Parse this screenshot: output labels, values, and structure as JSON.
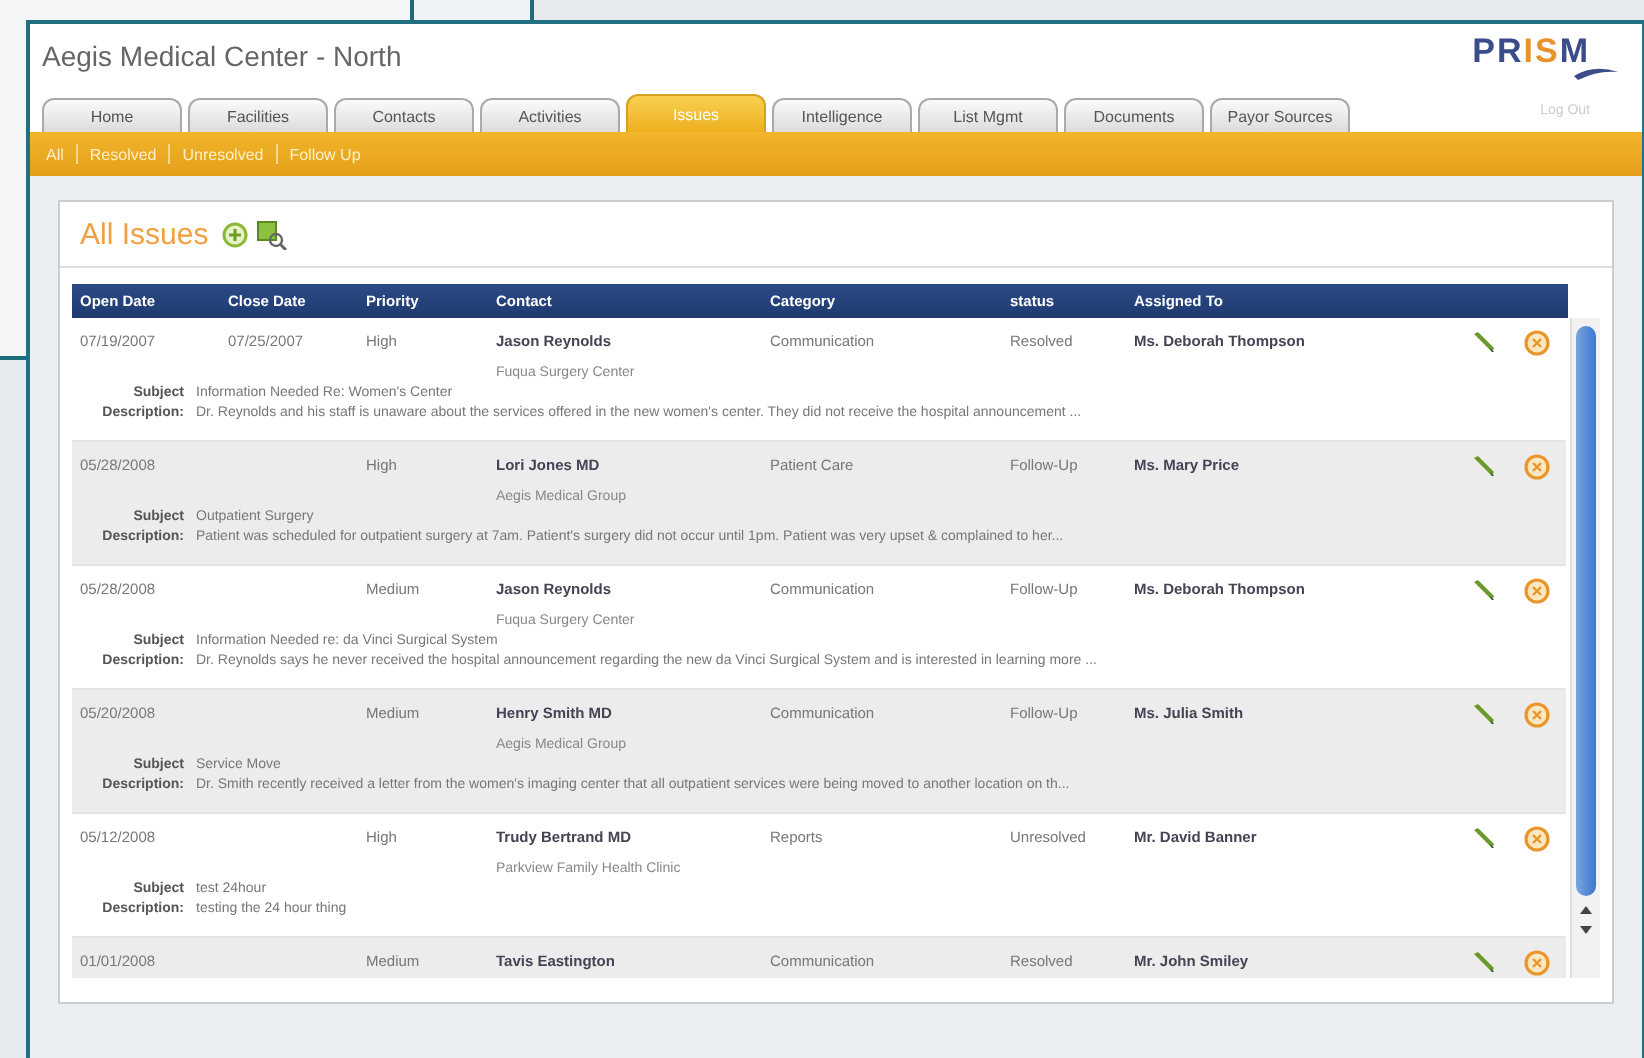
{
  "window": {
    "title": "Aegis Medical Center - North"
  },
  "logo": {
    "parts": [
      {
        "text": "PR",
        "accent": false
      },
      {
        "text": "IS",
        "accent": true
      },
      {
        "text": "M",
        "accent": false
      }
    ]
  },
  "tabs": [
    {
      "label": "Home",
      "selected": false
    },
    {
      "label": "Facilities",
      "selected": false
    },
    {
      "label": "Contacts",
      "selected": false
    },
    {
      "label": "Activities",
      "selected": false
    },
    {
      "label": "Issues",
      "selected": true
    },
    {
      "label": "Intelligence",
      "selected": false
    },
    {
      "label": "List Mgmt",
      "selected": false
    },
    {
      "label": "Documents",
      "selected": false
    },
    {
      "label": "Payor Sources",
      "selected": false
    }
  ],
  "log_out": "Log Out",
  "subnav": [
    "All",
    "Resolved",
    "Unresolved",
    "Follow Up"
  ],
  "panel": {
    "title": "All Issues"
  },
  "table": {
    "columns": [
      "Open Date",
      "Close Date",
      "Priority",
      "Contact",
      "Category",
      "status",
      "Assigned To"
    ],
    "rows": [
      {
        "open": "07/19/2007",
        "close": "07/25/2007",
        "priority": "High",
        "contact": "Jason Reynolds",
        "organization": "Fuqua Surgery Center",
        "category": "Communication",
        "status": "Resolved",
        "assigned": "Ms. Deborah Thompson",
        "subject_label": "Subject",
        "description_label": "Description:",
        "subject": "Information Needed Re: Women's Center",
        "description": "Dr. Reynolds and his staff is unaware about the services offered in the new women's center. They did not receive the hospital announcement ..."
      },
      {
        "open": "05/28/2008",
        "priority": "High",
        "contact": "Lori Jones MD",
        "organization": "Aegis Medical Group",
        "category": "Patient Care",
        "status": "Follow-Up",
        "assigned": "Ms. Mary Price",
        "subject_label": "Subject",
        "description_label": "Description:",
        "subject": "Outpatient Surgery",
        "description": "Patient was scheduled for outpatient surgery at 7am. Patient's surgery did not occur until 1pm. Patient was very upset & complained to her..."
      },
      {
        "open": "05/28/2008",
        "priority": "Medium",
        "contact": "Jason Reynolds",
        "organization": "Fuqua Surgery Center",
        "category": "Communication",
        "status": "Follow-Up",
        "assigned": "Ms. Deborah Thompson",
        "subject_label": "Subject",
        "description_label": "Description:",
        "subject": "Information Needed re: da Vinci Surgical System",
        "description": "Dr. Reynolds says he never received the hospital announcement regarding the new da Vinci Surgical System and is interested in learning more ..."
      },
      {
        "open": "05/20/2008",
        "priority": "Medium",
        "contact": "Henry Smith MD",
        "organization": "Aegis Medical Group",
        "category": "Communication",
        "status": "Follow-Up",
        "assigned": "Ms. Julia Smith",
        "subject_label": "Subject",
        "description_label": "Description:",
        "subject": "Service Move",
        "description": "Dr. Smith recently received a letter from the women's imaging center that all outpatient services were being moved to another location on th..."
      },
      {
        "open": "05/12/2008",
        "priority": "High",
        "contact": "Trudy Bertrand MD",
        "organization": "Parkview Family Health Clinic",
        "category": "Reports",
        "status": "Unresolved",
        "assigned": "Mr. David Banner",
        "subject_label": "Subject",
        "description_label": "Description:",
        "subject": "test 24hour",
        "description": "testing the 24 hour thing"
      },
      {
        "open": "01/01/2008",
        "priority": "Medium",
        "contact": "Tavis Eastington",
        "category": "Communication",
        "status": "Resolved",
        "assigned": "Mr. John Smiley"
      }
    ]
  }
}
